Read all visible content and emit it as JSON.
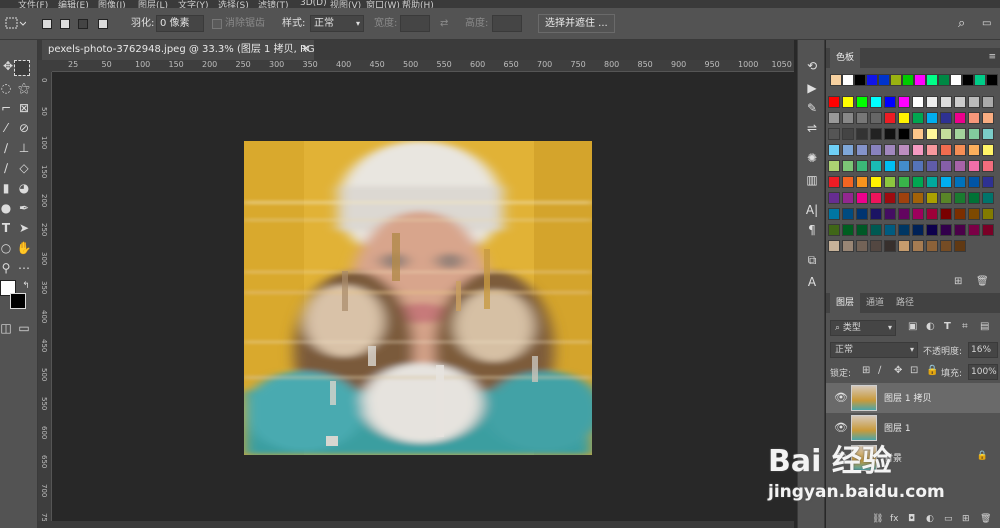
{
  "menubar": {
    "items": [
      "文件(F)",
      "编辑(E)",
      "图像(I)",
      "图层(L)",
      "文字(Y)",
      "选择(S)",
      "滤镜(T)",
      "3D(D)",
      "视图(V)",
      "窗口(W)",
      "帮助(H)"
    ]
  },
  "options": {
    "feather_label": "羽化:",
    "feather_value": "0 像素",
    "antialias_label": "消除锯齿",
    "style_label": "样式:",
    "style_value": "正常",
    "width_label": "宽度:",
    "height_label": "高度:",
    "select_mask_label": "选择并遮住 ..."
  },
  "document": {
    "tab_title": "pexels-photo-3762948.jpeg @ 33.3% (图层 1 拷贝, RGB/8) *",
    "ruler_h": [
      "25",
      "50",
      "100",
      "150",
      "200",
      "250",
      "300",
      "350",
      "400",
      "450",
      "500",
      "550",
      "600",
      "650",
      "700",
      "750",
      "800",
      "850",
      "900",
      "950",
      "1000",
      "1050"
    ],
    "ruler_v": [
      "0",
      "50",
      "100",
      "150",
      "200",
      "250",
      "300",
      "350",
      "400",
      "450",
      "500",
      "550",
      "600",
      "650",
      "700",
      "750"
    ]
  },
  "swatches_panel": {
    "title": "色板",
    "recent": [
      "#f7d1a0",
      "#ffffff",
      "#000000",
      "#1014e8",
      "#0033cc",
      "#99b211",
      "#00cc00",
      "#ff00ff",
      "#00ff88",
      "#008844",
      "#ffffff",
      "#000000",
      "#00cc88",
      "#000000"
    ],
    "rows": [
      [
        "#ff0000",
        "#ffff00",
        "#00ff00",
        "#00ffff",
        "#0000ff",
        "#ff00ff",
        "#ffffff",
        "#eeeeee",
        "#dddddd",
        "#cccccc",
        "#bbbbbb",
        "#aaaaaa"
      ],
      [
        "#999999",
        "#888888",
        "#777777",
        "#666666",
        "#ee1c24",
        "#fff200",
        "#00a650",
        "#00aeef",
        "#2e3192",
        "#ec008c",
        "#f7977a",
        "#f9ad81"
      ],
      [
        "#555555",
        "#444444",
        "#333333",
        "#222222",
        "#111111",
        "#000000",
        "#fdc68a",
        "#fff79a",
        "#c4df9b",
        "#a3d39c",
        "#82ca9d",
        "#7bcdc8"
      ],
      [
        "#6ecff6",
        "#7ea7d8",
        "#8493ca",
        "#8882be",
        "#a187be",
        "#bc8dbf",
        "#f49ac2",
        "#f6989d",
        "#f26c4f",
        "#f68e55",
        "#fbaf5c",
        "#fff467"
      ],
      [
        "#acd372",
        "#7cc576",
        "#3bb878",
        "#1abbb4",
        "#00bff3",
        "#438cca",
        "#5574b9",
        "#605ca8",
        "#855fa8",
        "#a763a8",
        "#f06ea9",
        "#f26d7d"
      ],
      [
        "#ed1c24",
        "#f26522",
        "#f7941d",
        "#fff200",
        "#8dc63f",
        "#39b54a",
        "#00a651",
        "#00a99d",
        "#00aeef",
        "#0072bc",
        "#0054a6",
        "#2e3192"
      ],
      [
        "#662d91",
        "#92278f",
        "#ec008c",
        "#ed145b",
        "#9e0b0f",
        "#a0410d",
        "#a36209",
        "#aba000",
        "#598527",
        "#1a7b30",
        "#007236",
        "#00746b"
      ],
      [
        "#0076a3",
        "#004b80",
        "#003471",
        "#1b1464",
        "#440e62",
        "#630460",
        "#9e005d",
        "#9e0039",
        "#790000",
        "#7b2e00",
        "#7d4900",
        "#827b00"
      ],
      [
        "#406618",
        "#005e20",
        "#005826",
        "#005952",
        "#005b7f",
        "#003663",
        "#002157",
        "#0d004c",
        "#32004b",
        "#4b0049",
        "#7b0046",
        "#7a0026"
      ],
      [
        "#c7b299",
        "#998675",
        "#736357",
        "#534741",
        "#37302d",
        "#c69c6d",
        "#a67c52",
        "#8c6239",
        "#754c24",
        "#603913",
        "#",
        "#"
      ]
    ]
  },
  "layers_panel": {
    "tabs": [
      "图层",
      "通道",
      "路径"
    ],
    "filter_label": "类型",
    "blend_mode": "正常",
    "opacity_label": "不透明度:",
    "opacity_value": "16%",
    "lock_label": "锁定:",
    "fill_label": "填充:",
    "fill_value": "100%",
    "layers": [
      {
        "name": "图层 1 拷贝",
        "selected": true
      },
      {
        "name": "图层 1",
        "selected": false
      },
      {
        "name": "背景",
        "selected": false
      }
    ]
  },
  "watermark": {
    "brand": "Bai 经验",
    "url": "jingyan.baidu.com"
  }
}
